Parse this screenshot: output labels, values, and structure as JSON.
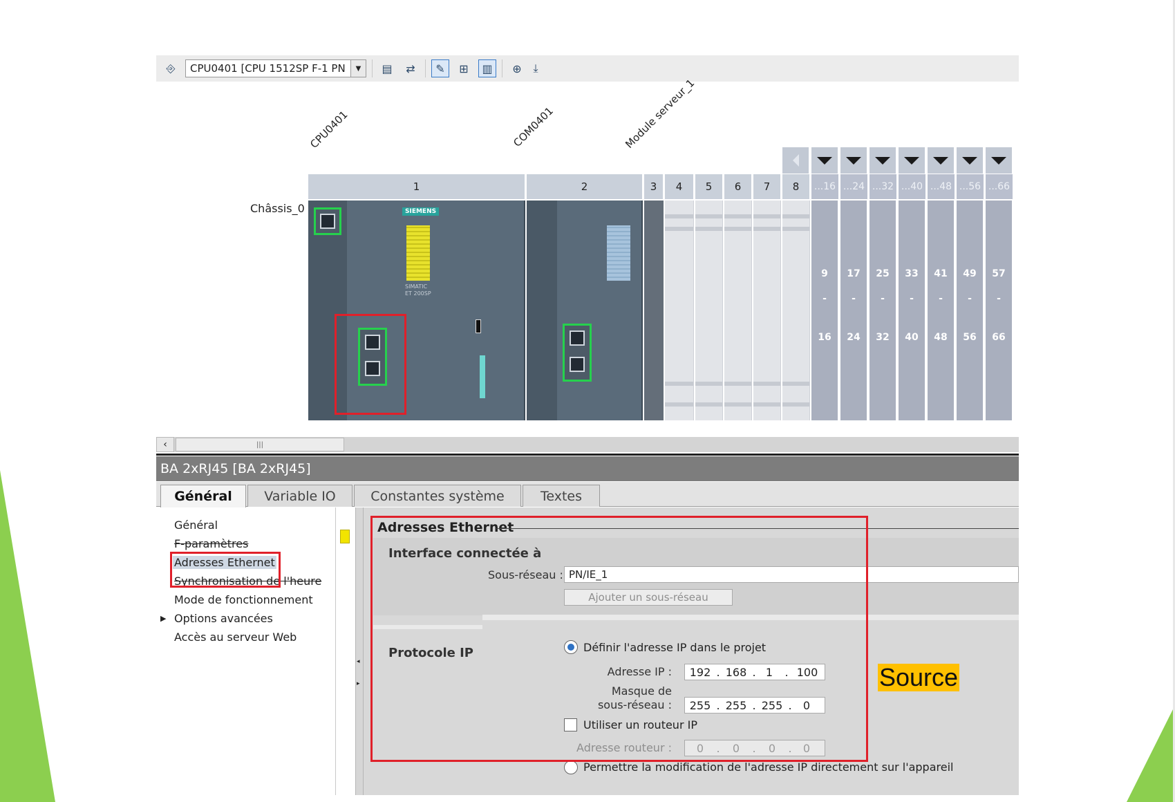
{
  "toolbar": {
    "device_selector": "CPU0401 [CPU 1512SP F-1 PN"
  },
  "rack": {
    "modules": [
      {
        "name": "CPU0401"
      },
      {
        "name": "COM0401"
      },
      {
        "name": "Module serveur_1"
      }
    ],
    "chassis_label": "Châssis_0",
    "slot_numbers": [
      "1",
      "2",
      "3",
      "4",
      "5",
      "6",
      "7",
      "8"
    ],
    "expansion_headers": [
      "...16",
      "...24",
      "...32",
      "...40",
      "...48",
      "...56",
      "...66"
    ],
    "expansion_ranges": [
      {
        "from": "9",
        "sep": "-",
        "to": "16"
      },
      {
        "from": "17",
        "sep": "-",
        "to": "24"
      },
      {
        "from": "25",
        "sep": "-",
        "to": "32"
      },
      {
        "from": "33",
        "sep": "-",
        "to": "40"
      },
      {
        "from": "41",
        "sep": "-",
        "to": "48"
      },
      {
        "from": "49",
        "sep": "-",
        "to": "56"
      },
      {
        "from": "57",
        "sep": "-",
        "to": "66"
      }
    ],
    "cpu_module": {
      "brand": "SIEMENS",
      "line1": "SIMATIC",
      "line2": "ET 200SP"
    }
  },
  "properties": {
    "title": "BA 2xRJ45 [BA 2xRJ45]",
    "tabs": [
      "Général",
      "Variable IO",
      "Constantes système",
      "Textes"
    ],
    "nav": {
      "items": [
        "Général",
        "F-paramètres",
        "Adresses Ethernet",
        "Synchronisation de l'heure",
        "Mode de fonctionnement",
        "Options avancées",
        "Accès au serveur Web"
      ],
      "selected": "Adresses Ethernet"
    },
    "section_title": "Adresses Ethernet",
    "interface": {
      "title": "Interface connectée à",
      "subnet_label": "Sous-réseau :",
      "subnet_value": "PN/IE_1",
      "add_subnet_button": "Ajouter un sous-réseau"
    },
    "ip_protocol": {
      "title": "Protocole IP",
      "option_project": "Définir l'adresse IP dans le projet",
      "ip_label": "Adresse IP :",
      "ip": [
        "192",
        "168",
        "1",
        "100"
      ],
      "mask_label_1": "Masque de",
      "mask_label_2": "sous-réseau :",
      "mask": [
        "255",
        "255",
        "255",
        "0"
      ],
      "use_router": "Utiliser un routeur IP",
      "router_label": "Adresse routeur :",
      "router": [
        "0",
        "0",
        "0",
        "0"
      ],
      "option_device": "Permettre la modification de l'adresse IP directement sur l'appareil"
    }
  },
  "annotation": {
    "source_label": "Source"
  },
  "colors": {
    "highlight_red": "#e0202a",
    "port_green": "#26d14d",
    "source_tag": "#ffc000",
    "slide_green": "#8ccf4f"
  }
}
